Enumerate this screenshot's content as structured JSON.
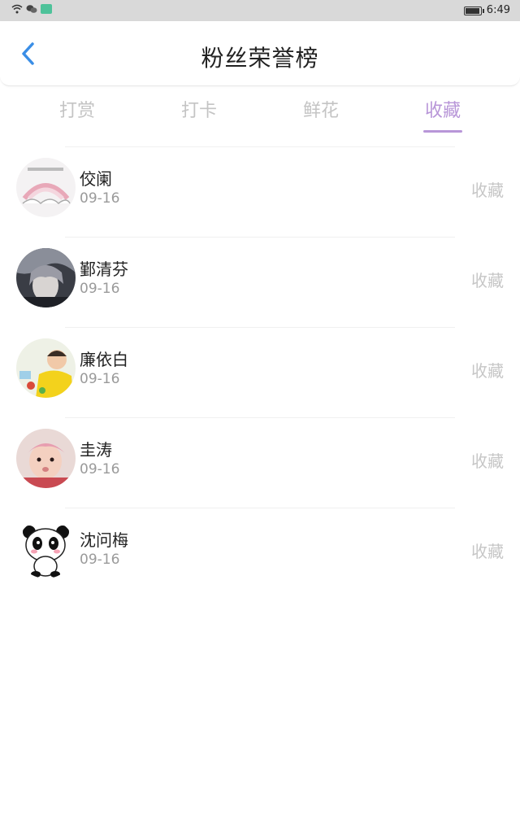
{
  "status_bar": {
    "time": "6:49",
    "battery_level": 0.85
  },
  "header": {
    "title": "粉丝荣誉榜",
    "back_icon": "chevron-left-icon"
  },
  "tabs": [
    {
      "label": "打赏",
      "active": false
    },
    {
      "label": "打卡",
      "active": false
    },
    {
      "label": "鲜花",
      "active": false
    },
    {
      "label": "收藏",
      "active": true
    }
  ],
  "colors": {
    "accent": "#b896d8",
    "back_icon": "#3a8ee6"
  },
  "list": [
    {
      "name": "佼阑",
      "date": "09-16",
      "action": "收藏",
      "avatar": "rainbow-avatar"
    },
    {
      "name": "鄞清芬",
      "date": "09-16",
      "action": "收藏",
      "avatar": "anime-avatar"
    },
    {
      "name": "廉依白",
      "date": "09-16",
      "action": "收藏",
      "avatar": "child-avatar"
    },
    {
      "name": "圭涛",
      "date": "09-16",
      "action": "收藏",
      "avatar": "baby-avatar"
    },
    {
      "name": "沈问梅",
      "date": "09-16",
      "action": "收藏",
      "avatar": "panda-avatar"
    }
  ]
}
